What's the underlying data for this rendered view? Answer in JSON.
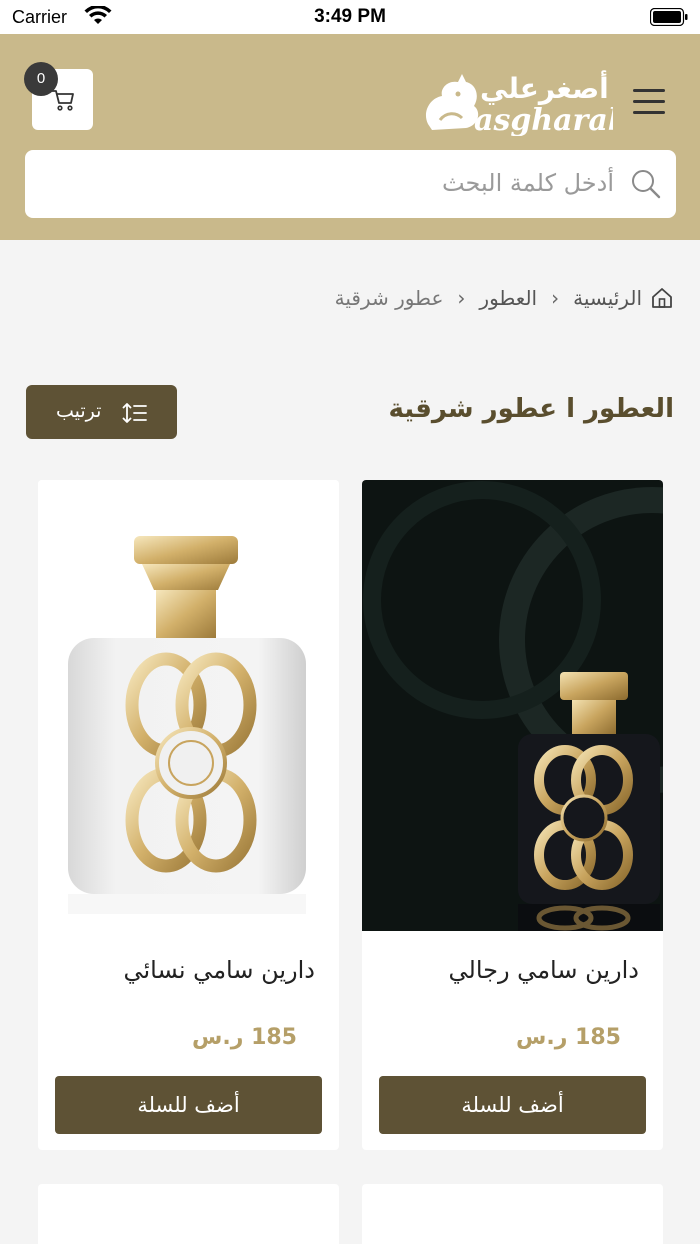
{
  "status_bar": {
    "carrier": "Carrier",
    "time": "3:49 PM"
  },
  "header": {
    "cart_count": "0",
    "logo_arabic": "أصغرعلي",
    "logo_latin": "asgharali",
    "search_placeholder": "أدخل كلمة البحث",
    "icons": [
      "cart-icon",
      "hamburger-menu-icon",
      "search-icon"
    ]
  },
  "breadcrumb": {
    "items": [
      "الرئيسية",
      "العطور",
      "عطور شرقية"
    ]
  },
  "page": {
    "title": "العطور ا عطور شرقية",
    "sort_label": "ترتيب"
  },
  "products": [
    {
      "name": "دارين سامي رجالي",
      "price": "185 ر.س",
      "add_label": "أضف للسلة"
    },
    {
      "name": "دارين سامي نسائي",
      "price": "185 ر.س",
      "add_label": "أضف للسلة"
    }
  ],
  "colors": {
    "header_bg": "#c9b98b",
    "accent_dark": "#5e5235",
    "price": "#b59f68",
    "title": "#5a4e2e"
  }
}
